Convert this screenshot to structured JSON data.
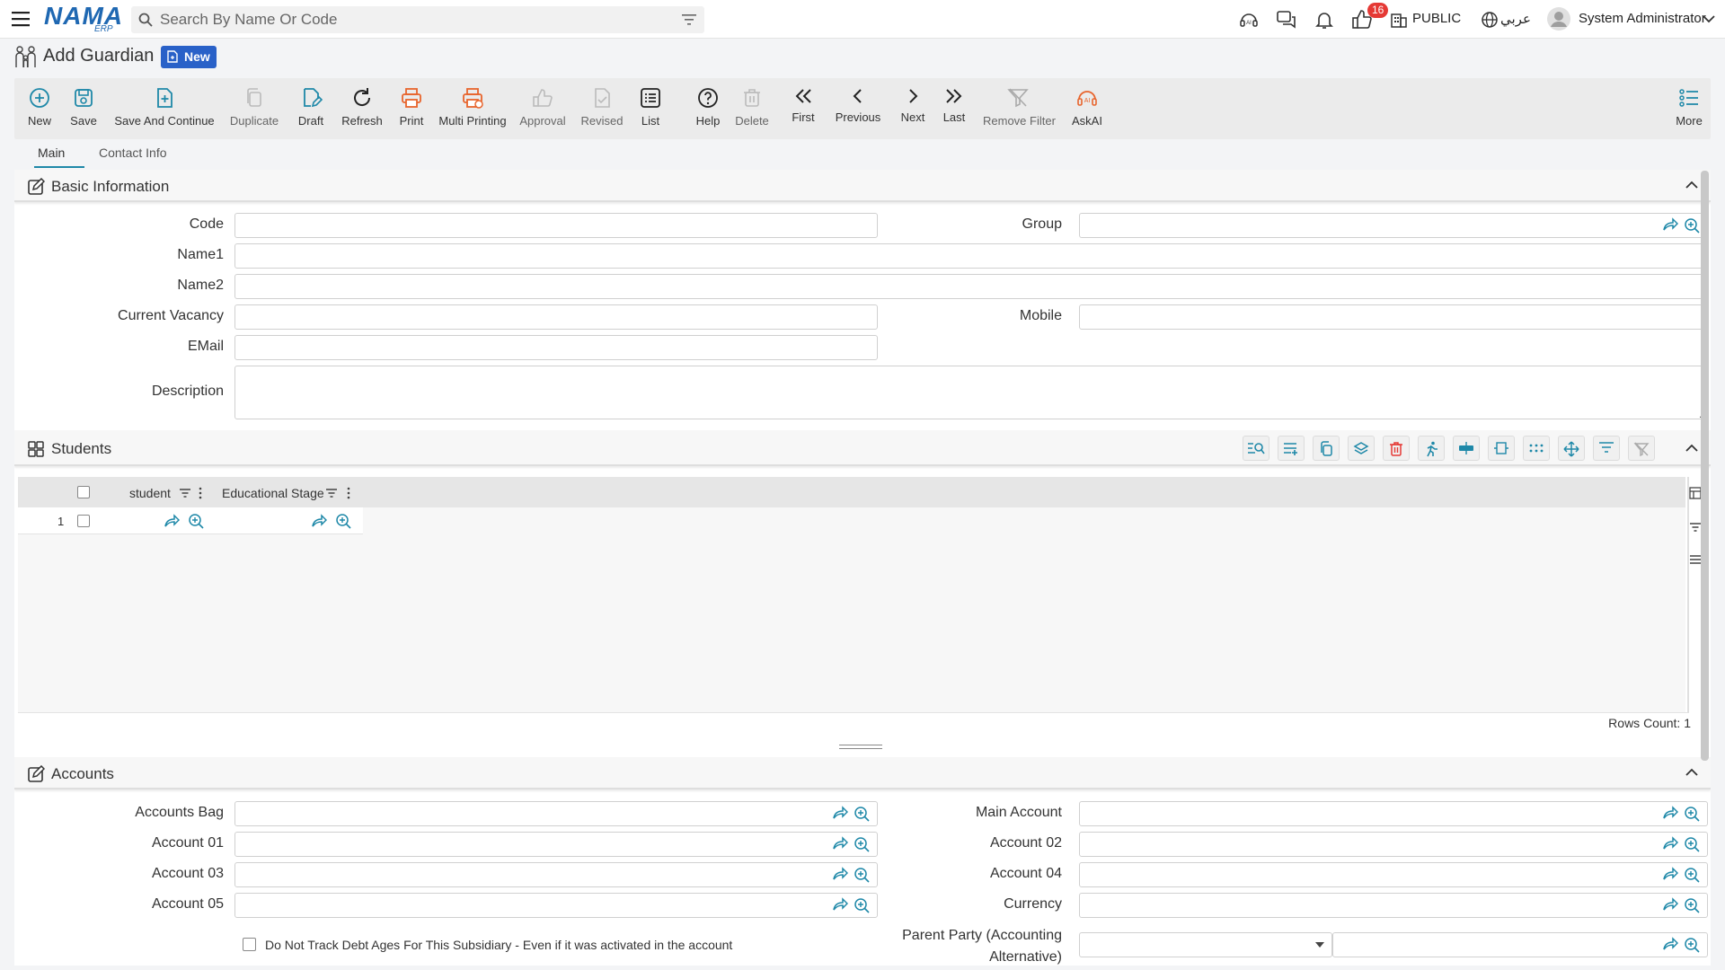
{
  "header": {
    "logo_main": "NAMA",
    "logo_sub": "ERP",
    "search_placeholder": "Search By Name Or Code",
    "notifications_count": "16",
    "branch": "PUBLIC",
    "language": "عربي",
    "user": "System Administrator"
  },
  "page": {
    "title": "Add Guardian",
    "status_badge": "New"
  },
  "toolbar": {
    "new": "New",
    "save": "Save",
    "save_continue": "Save And Continue",
    "duplicate": "Duplicate",
    "draft": "Draft",
    "refresh": "Refresh",
    "print": "Print",
    "multi_printing": "Multi Printing",
    "approval": "Approval",
    "revised": "Revised",
    "list": "List",
    "help": "Help",
    "delete": "Delete",
    "first": "First",
    "previous": "Previous",
    "next": "Next",
    "last": "Last",
    "remove_filter": "Remove Filter",
    "askai": "AskAI",
    "more": "More"
  },
  "tabs": {
    "main": "Main",
    "contact_info": "Contact Info"
  },
  "basic_info": {
    "title": "Basic Information",
    "code": "Code",
    "group": "Group",
    "name1": "Name1",
    "name2": "Name2",
    "current_vacancy": "Current Vacancy",
    "mobile": "Mobile",
    "email": "EMail",
    "description": "Description"
  },
  "students": {
    "title": "Students",
    "columns": [
      "student",
      "Educational Stage"
    ],
    "row_number": "1",
    "rows_count_label": "Rows Count: 1"
  },
  "accounts": {
    "title": "Accounts",
    "accounts_bag": "Accounts Bag",
    "main_account": "Main Account",
    "account_01": "Account 01",
    "account_02": "Account 02",
    "account_03": "Account 03",
    "account_04": "Account 04",
    "account_05": "Account 05",
    "currency": "Currency",
    "parent_party_line1": "Parent Party (Accounting",
    "parent_party_line2": "Alternative)",
    "debt_checkbox": "Do Not Track Debt Ages For This Subsidiary - Even if it was activated in the account"
  },
  "colors": {
    "accent_teal": "#1e88a8",
    "brand_blue": "#1f68b2",
    "new_badge": "#2961c8",
    "print_orange": "#e8642c",
    "badge_red": "#e53935"
  }
}
